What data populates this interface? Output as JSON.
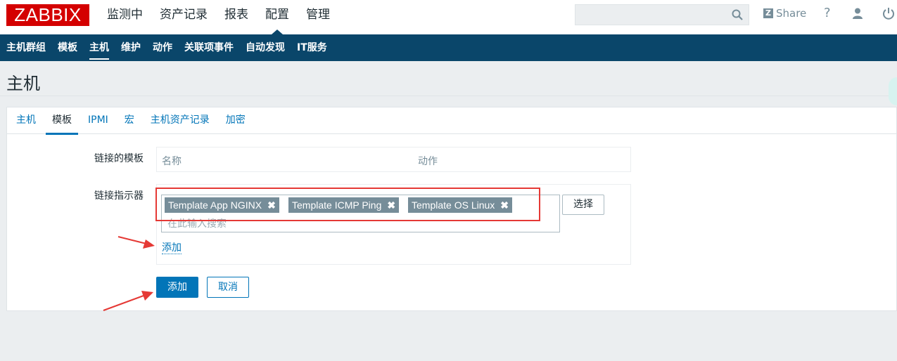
{
  "header": {
    "logo": "ZABBIX",
    "nav": [
      "监测中",
      "资产记录",
      "报表",
      "配置",
      "管理"
    ],
    "active_nav": "配置",
    "search_placeholder": "",
    "share_label": "Share",
    "help_label": "?"
  },
  "subnav": {
    "items": [
      "主机群组",
      "模板",
      "主机",
      "维护",
      "动作",
      "关联项事件",
      "自动发现",
      "IT服务"
    ],
    "active": "主机"
  },
  "page": {
    "title": "主机"
  },
  "tabs": {
    "items": [
      "主机",
      "模板",
      "IPMI",
      "宏",
      "主机资产记录",
      "加密"
    ],
    "active": "模板"
  },
  "form": {
    "linked_templates_label": "链接的模板",
    "columns": [
      "名称",
      "动作"
    ],
    "link_new_label": "链接指示器",
    "chips": [
      "Template App NGINX",
      "Template ICMP Ping",
      "Template OS Linux"
    ],
    "search_placeholder": "在此输入搜索",
    "select_button": "选择",
    "add_link": "添加",
    "submit_button": "添加",
    "cancel_button": "取消"
  },
  "colors": {
    "brand_red": "#d40000",
    "subnav_bg": "#0a466a",
    "primary": "#0275b8",
    "annotation_red": "#e53935"
  }
}
